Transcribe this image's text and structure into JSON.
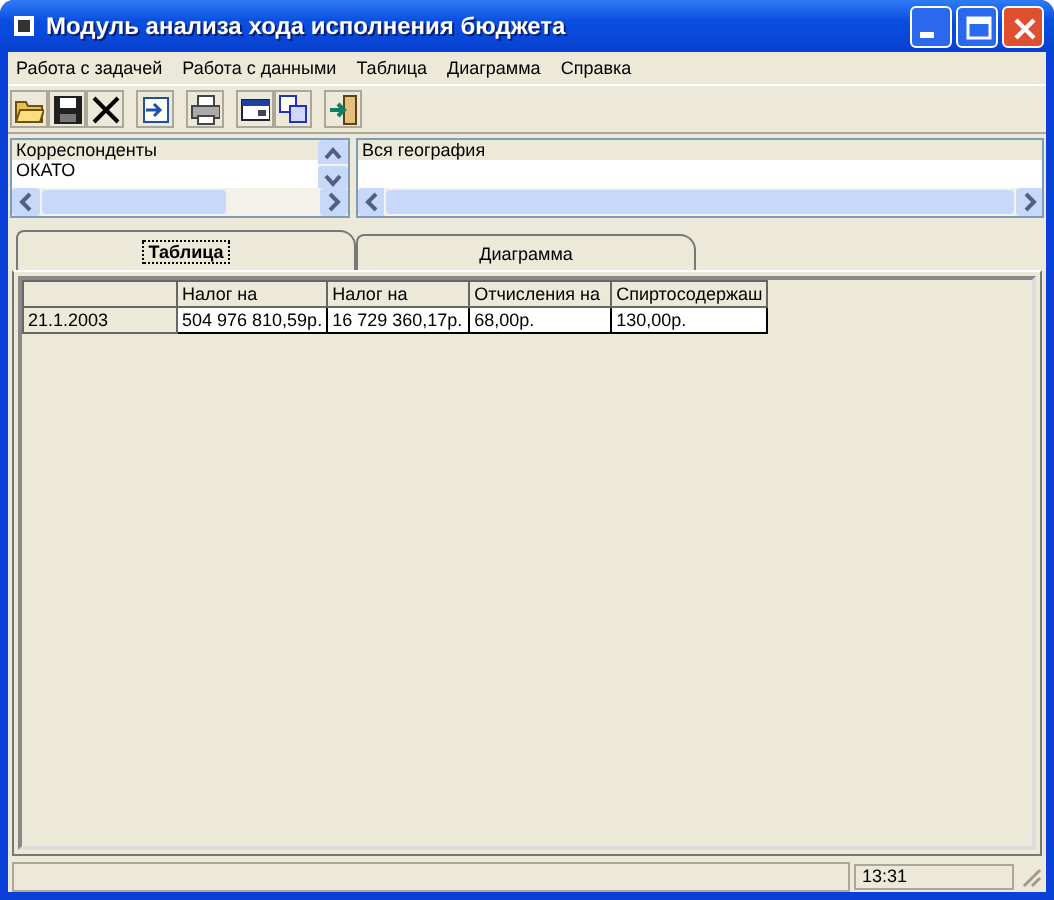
{
  "window": {
    "title": "Модуль анализа хода исполнения бюджета"
  },
  "menu": [
    "Работа с задачей",
    "Работа с данными",
    "Таблица",
    "Диаграмма",
    "Справка"
  ],
  "left_list": {
    "items": [
      "Корреспонденты",
      "ОКАТО"
    ]
  },
  "right_list": {
    "items": [
      "Вся география"
    ]
  },
  "tabs": [
    {
      "label": "Таблица",
      "selected": true
    },
    {
      "label": "Диаграмма",
      "selected": false
    }
  ],
  "table": {
    "columns": [
      "",
      "Налог на",
      "Налог на",
      "Отчисления на",
      "Спиртосодержаш"
    ],
    "rows": [
      [
        "21.1.2003",
        "504 976 810,59р.",
        "16 729 360,17р.",
        "68,00р.",
        "130,00р."
      ]
    ]
  },
  "status_bar": {
    "time": "13:31"
  }
}
